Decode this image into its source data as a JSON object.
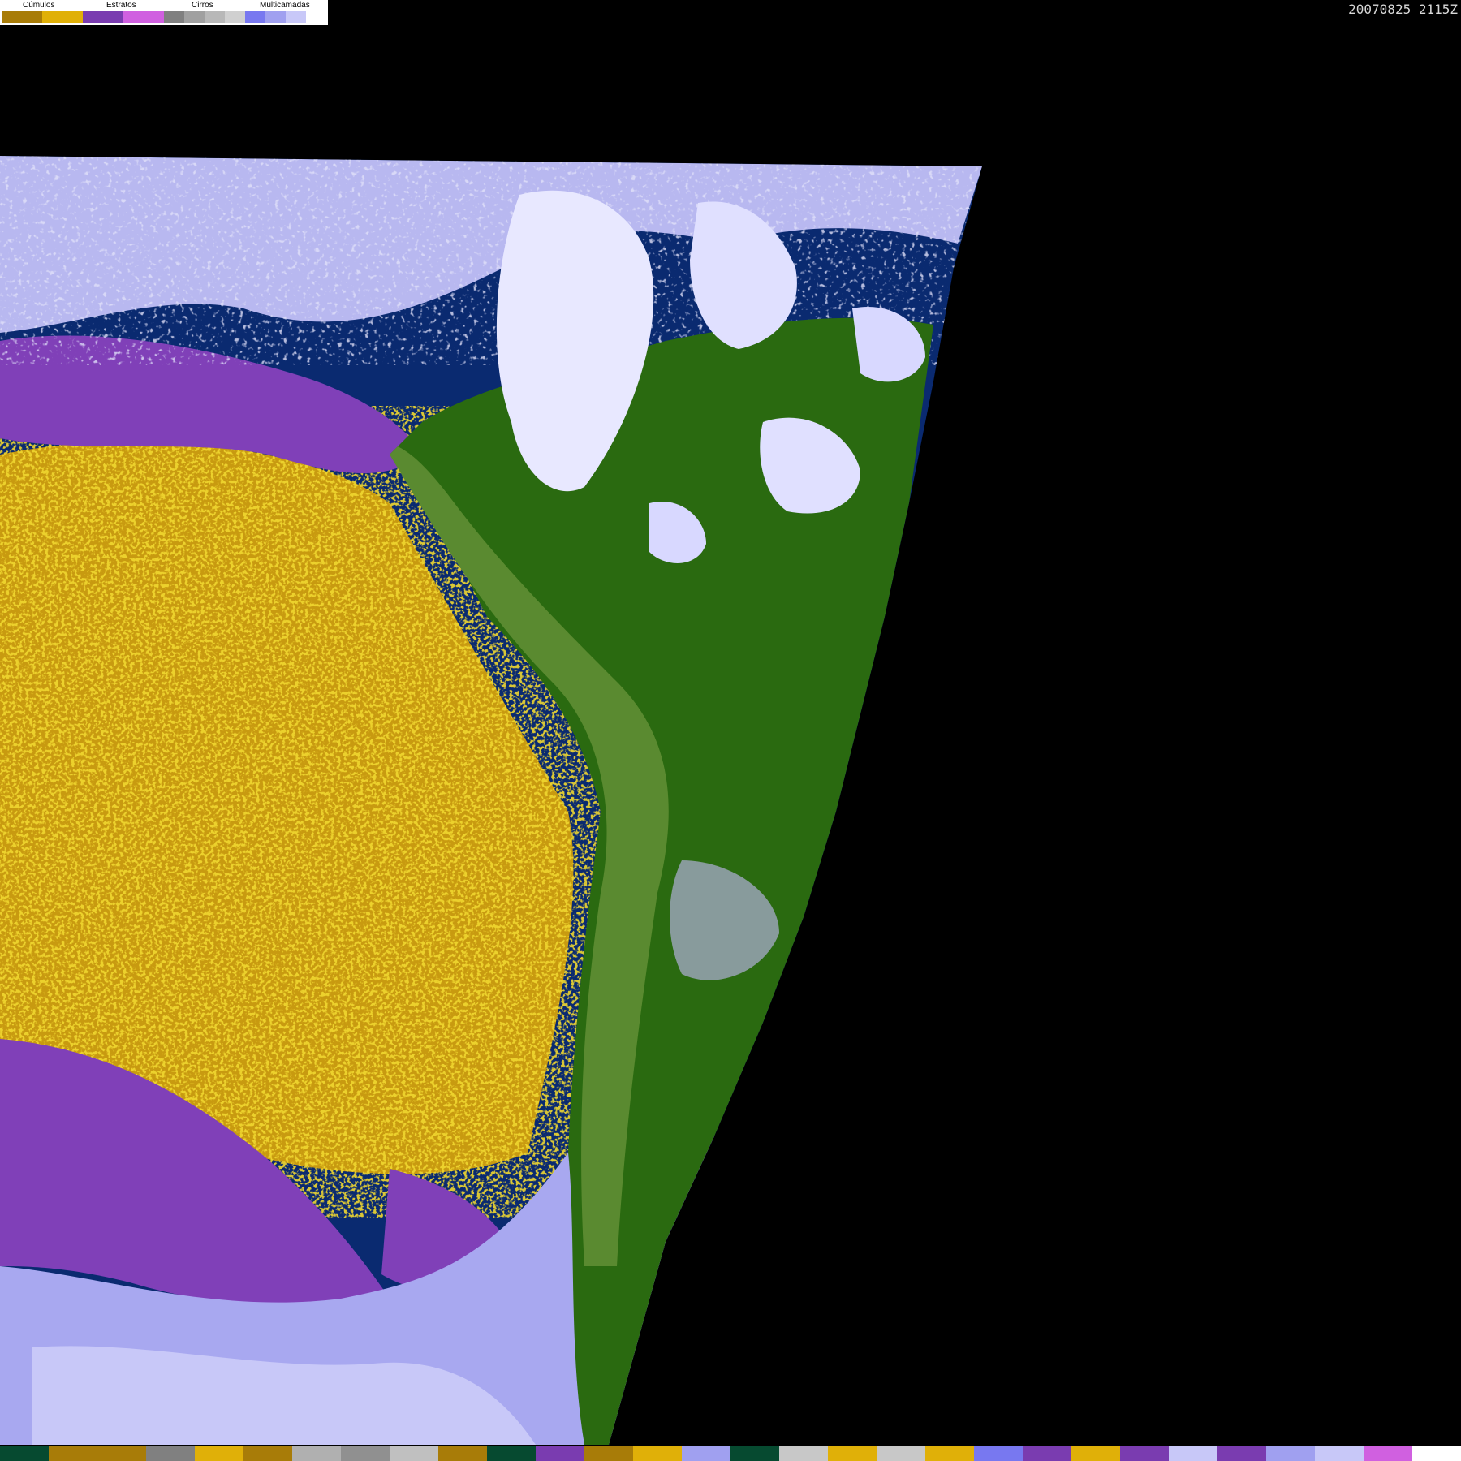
{
  "timestamp": "20070825 2115Z",
  "legend": {
    "groups": [
      {
        "label": "Cúmulos"
      },
      {
        "label": "Estratos"
      },
      {
        "label": "Cirros"
      },
      {
        "label": "Multicamadas"
      }
    ],
    "swatch_colors": [
      "#a87c08",
      "#a87c08",
      "#e0b008",
      "#e0b008",
      "#7a3cb0",
      "#7a3cb0",
      "#d060e0",
      "#d060e0",
      "#808080",
      "#a0a0a0",
      "#b8b8b8",
      "#d0d0d0",
      "#7878f0",
      "#a0a0f0",
      "#c8c8f8",
      "#ffffff"
    ]
  },
  "map_colors": {
    "ocean": "#0a2a70",
    "land_forest": "#2a6a10",
    "land_andes": "#5a8a30",
    "cumulus": "#e0b008",
    "stratus": "#8040b8",
    "cirrus_light": "#b8b8f0",
    "cirrus_white": "#e8e8ff",
    "space": "#000000"
  },
  "bottom_bar_colors": [
    "#064a30",
    "#a87c08",
    "#a87c08",
    "#808080",
    "#e0b008",
    "#a87c08",
    "#b0b0b0",
    "#909090",
    "#c0c0c0",
    "#a87c08",
    "#064a30",
    "#7a3cb0",
    "#a87c08",
    "#e0b008",
    "#a0a0f0",
    "#064a30",
    "#c8c8c8",
    "#e0b008",
    "#c8c8c8",
    "#e0b008",
    "#7878f0",
    "#7a3cb0",
    "#e0b008",
    "#7a3cb0",
    "#c8c8f8",
    "#7a3cb0",
    "#a0a0f0",
    "#c8c8f8",
    "#d060e0",
    "#ffffff"
  ]
}
